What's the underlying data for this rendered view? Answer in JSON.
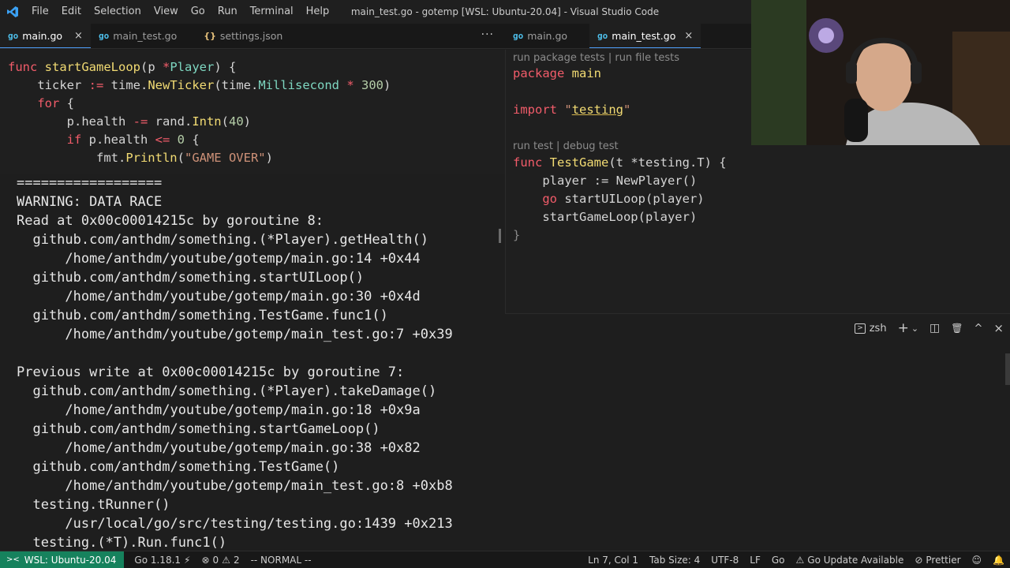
{
  "window": {
    "title": "main_test.go - gotemp [WSL: Ubuntu-20.04] - Visual Studio Code"
  },
  "menu": [
    "File",
    "Edit",
    "Selection",
    "View",
    "Go",
    "Run",
    "Terminal",
    "Help"
  ],
  "tabs_left": [
    {
      "label": "main.go",
      "icon": "go"
    },
    {
      "label": "main_test.go",
      "icon": "go"
    },
    {
      "label": "settings.json",
      "icon": "{}"
    }
  ],
  "tabs_right": [
    {
      "label": "main.go",
      "icon": "go"
    },
    {
      "label": "main_test.go",
      "icon": "go",
      "close": "×"
    }
  ],
  "left_tab_close": "×",
  "more_actions": "···",
  "left_code": [
    [
      [
        "kw2",
        "func "
      ],
      [
        "fn",
        "startGameLoop"
      ],
      [
        "",
        "(p "
      ],
      [
        "kw2",
        "*"
      ],
      [
        "ty",
        "Player"
      ],
      [
        "",
        ") {"
      ]
    ],
    [
      [
        "",
        "    ticker "
      ],
      [
        "kw2",
        ":="
      ],
      [
        "",
        " time."
      ],
      [
        "fn",
        "NewTicker"
      ],
      [
        "",
        "(time."
      ],
      [
        "ty",
        "Millisecond"
      ],
      [
        "",
        " "
      ],
      [
        "kw2",
        "*"
      ],
      [
        "",
        " "
      ],
      [
        "num",
        "300"
      ],
      [
        "",
        ")"
      ]
    ],
    [
      [
        "",
        "    "
      ],
      [
        "kw2",
        "for"
      ],
      [
        "",
        " {"
      ]
    ],
    [
      [
        "",
        "        p.health "
      ],
      [
        "kw2",
        "-="
      ],
      [
        "",
        " rand."
      ],
      [
        "fn",
        "Intn"
      ],
      [
        "",
        "("
      ],
      [
        "num",
        "40"
      ],
      [
        "",
        ")"
      ]
    ],
    [
      [
        "",
        "        "
      ],
      [
        "kw2",
        "if"
      ],
      [
        "",
        " p.health "
      ],
      [
        "kw2",
        "<="
      ],
      [
        "",
        " "
      ],
      [
        "num",
        "0"
      ],
      [
        "",
        " {"
      ]
    ],
    [
      [
        "",
        "            fmt."
      ],
      [
        "fn",
        "Println"
      ],
      [
        "",
        "("
      ],
      [
        "str",
        "\"GAME OVER\""
      ],
      [
        "",
        ")"
      ]
    ]
  ],
  "terminal_lines": [
    "==================",
    "WARNING: DATA RACE",
    "Read at 0x00c00014215c by goroutine 8:",
    "  github.com/anthdm/something.(*Player).getHealth()",
    "      /home/anthdm/youtube/gotemp/main.go:14 +0x44",
    "  github.com/anthdm/something.startUILoop()",
    "      /home/anthdm/youtube/gotemp/main.go:30 +0x4d",
    "  github.com/anthdm/something.TestGame.func1()",
    "      /home/anthdm/youtube/gotemp/main_test.go:7 +0x39",
    "",
    "Previous write at 0x00c00014215c by goroutine 7:",
    "  github.com/anthdm/something.(*Player).takeDamage()",
    "      /home/anthdm/youtube/gotemp/main.go:18 +0x9a",
    "  github.com/anthdm/something.startGameLoop()",
    "      /home/anthdm/youtube/gotemp/main.go:38 +0x82",
    "  github.com/anthdm/something.TestGame()",
    "      /home/anthdm/youtube/gotemp/main_test.go:8 +0xb8",
    "  testing.tRunner()",
    "      /usr/local/go/src/testing/testing.go:1439 +0x213",
    "  testing.(*T).Run.func1()"
  ],
  "right_editor": {
    "lens_package": "run package tests | run file tests",
    "lens_test": "run test | debug test",
    "line_package_kw": "package",
    "line_package_name": "main",
    "line_import_kw": "import",
    "line_import_str": "testing",
    "func_kw": "func",
    "func_name": "TestGame",
    "func_params": "(t *testing.T) {",
    "body1": "    player := NewPlayer()",
    "body2_kw": "go",
    "body2_rest": " startUILoop(player)",
    "body3": "    startGameLoop(player)",
    "close_brace": "}"
  },
  "panel": {
    "shell": "zsh",
    "add": "+",
    "chevron": "⌄",
    "split": "◫",
    "trash": "🗑",
    "maximize": "^",
    "close": "×"
  },
  "status": {
    "remote": "WSL: Ubuntu-20.04",
    "go_version": "Go 1.18.1",
    "errors": "0",
    "warnings": "2",
    "vim_mode": "-- NORMAL --",
    "cursor": "Ln 7, Col 1",
    "tab_size": "Tab Size: 4",
    "encoding": "UTF-8",
    "eol": "LF",
    "language": "Go",
    "go_update": "Go Update Available",
    "prettier": "Prettier"
  }
}
